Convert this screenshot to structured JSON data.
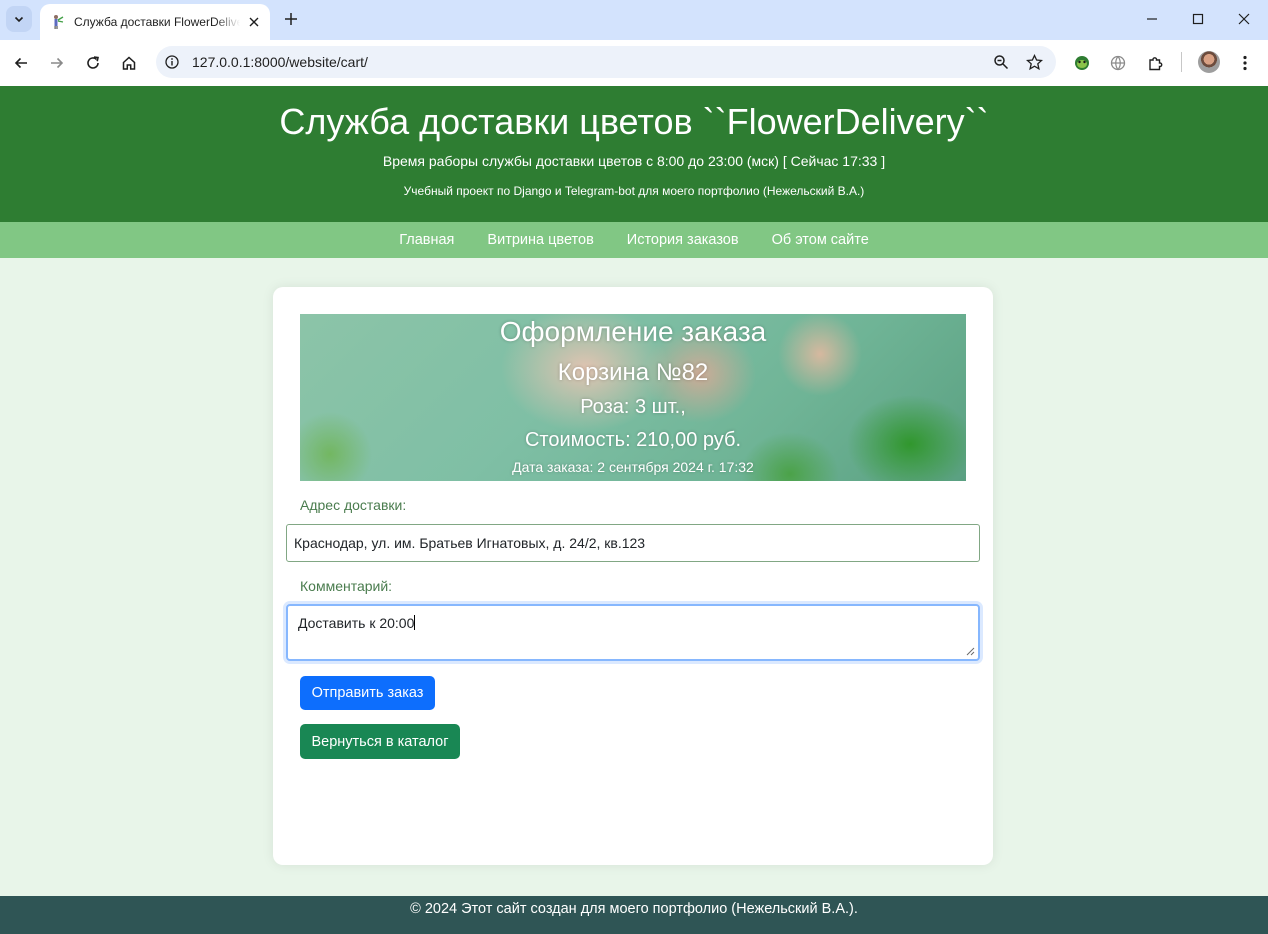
{
  "browser": {
    "tab_title": "Служба доставки FlowerDelivery",
    "url": "127.0.0.1:8000/website/cart/"
  },
  "header": {
    "title": "Служба доставки цветов ``FlowerDelivery``",
    "hours": "Время раборы службы доставки цветов с 8:00 до 23:00 (мск) [ Сейчас 17:33 ]",
    "project": "Учебный проект по Django и Telegram-bot для моего портфолио (Нежельский В.А.)"
  },
  "nav": {
    "items": [
      {
        "label": "Главная"
      },
      {
        "label": "Витрина цветов"
      },
      {
        "label": "История заказов"
      },
      {
        "label": "Об этом сайте"
      }
    ]
  },
  "order": {
    "heading": "Оформление заказа",
    "cart": "Корзина №82",
    "items": "Роза: 3 шт.,",
    "cost": "Стоимость: 210,00 руб.",
    "date": "Дата заказа: 2 сентября 2024 г. 17:32"
  },
  "form": {
    "address_label": "Адрес доставки:",
    "address_value": "Краснодар, ул. им. Братьев Игнатовых, д. 24/2, кв.123",
    "comment_label": "Комментарий:",
    "comment_value": "Доставить к 20:00",
    "submit_label": "Отправить заказ",
    "back_label": "Вернуться в каталог"
  },
  "footer": {
    "text": "© 2024 Этот сайт создан для моего портфолио (Нежельский В.А.)."
  },
  "colors": {
    "header_bg": "#2e7d32",
    "nav_bg": "#81c784",
    "page_bg": "#e8f5e9",
    "submit_button": "#0d6efd",
    "back_button": "#198754",
    "footer_bg": "#2f5555"
  }
}
